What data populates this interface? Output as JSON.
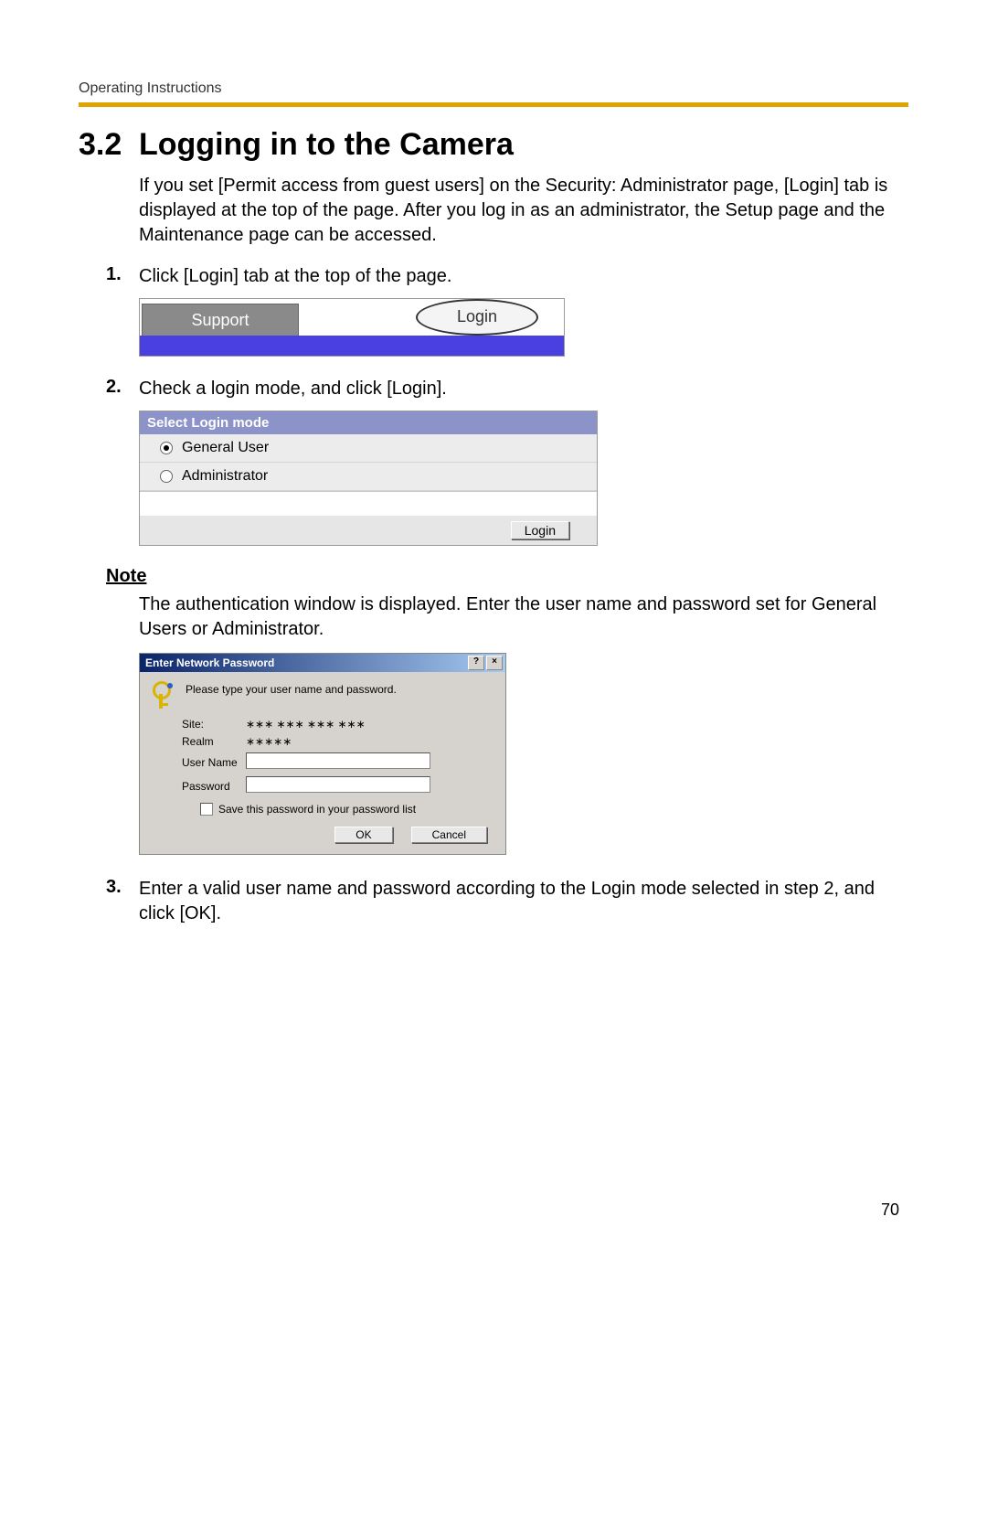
{
  "header": {
    "running_head": "Operating Instructions"
  },
  "section": {
    "number": "3.2",
    "title": "Logging in to the Camera",
    "intro": "If you set [Permit access from guest users] on the Security: Administrator page, [Login] tab is displayed at the top of the page. After you log in as an administrator, the Setup page and the Maintenance page can be accessed."
  },
  "steps": {
    "s1": {
      "num": "1.",
      "text": "Click [Login] tab at the top of the page."
    },
    "s2": {
      "num": "2.",
      "text": "Check a login mode, and click [Login]."
    },
    "s3": {
      "num": "3.",
      "text": "Enter a valid user name and password according to the Login mode selected in step 2, and click [OK]."
    }
  },
  "fig_tabs": {
    "support_label": "Support",
    "login_label": "Login"
  },
  "fig_login_panel": {
    "title": "Select Login mode",
    "option_general": "General User",
    "option_admin": "Administrator",
    "login_button": "Login"
  },
  "note": {
    "heading": "Note",
    "body": "The authentication window is displayed. Enter the user name and password set for General Users or Administrator."
  },
  "fig_auth": {
    "title": "Enter Network Password",
    "help_glyph": "?",
    "close_glyph": "×",
    "prompt": "Please type your user name and password.",
    "site_label": "Site:",
    "site_value": "∗∗∗ ∗∗∗ ∗∗∗ ∗∗∗",
    "realm_label": "Realm",
    "realm_value": "∗∗∗∗∗",
    "user_label": "User Name",
    "pass_label": "Password",
    "save_label": "Save this password in your password list",
    "ok_button": "OK",
    "cancel_button": "Cancel"
  },
  "page_number": "70"
}
